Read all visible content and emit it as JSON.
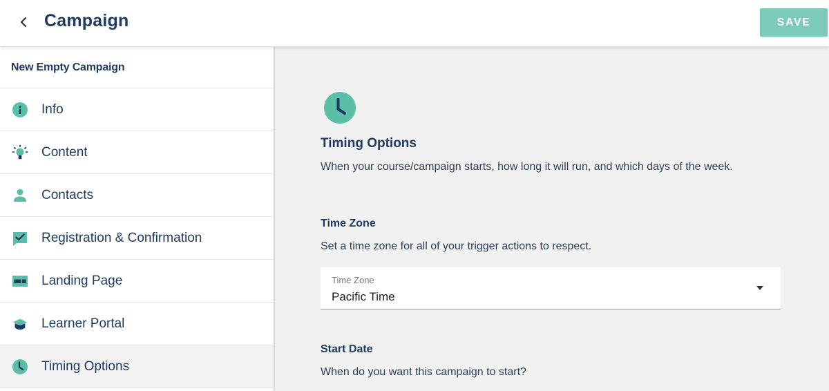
{
  "header": {
    "title": "Campaign",
    "save_label": "SAVE"
  },
  "sidebar": {
    "campaign_name": "New Empty Campaign",
    "items": [
      {
        "label": "Info",
        "icon": "info-icon"
      },
      {
        "label": "Content",
        "icon": "lightbulb-icon"
      },
      {
        "label": "Contacts",
        "icon": "person-icon"
      },
      {
        "label": "Registration & Confirmation",
        "icon": "check-box-icon"
      },
      {
        "label": "Landing Page",
        "icon": "web-page-icon"
      },
      {
        "label": "Learner Portal",
        "icon": "graduation-cap-icon"
      },
      {
        "label": "Timing Options",
        "icon": "clock-icon",
        "active": true
      }
    ]
  },
  "main": {
    "hero_icon": "clock-icon",
    "timing": {
      "title": "Timing Options",
      "description": "When your course/campaign starts, how long it will run, and which days of the week."
    },
    "time_zone": {
      "title": "Time Zone",
      "description": "Set a time zone for all of your trigger actions to respect.",
      "field_label": "Time Zone",
      "value": "Pacific Time"
    },
    "start_date": {
      "title": "Start Date",
      "description": "When do you want this campaign to start?"
    }
  },
  "colors": {
    "accent": "#5bbfa8",
    "save_button": "#7ccbb8",
    "navy": "#1e3a5f",
    "background": "#f1f1f1"
  }
}
